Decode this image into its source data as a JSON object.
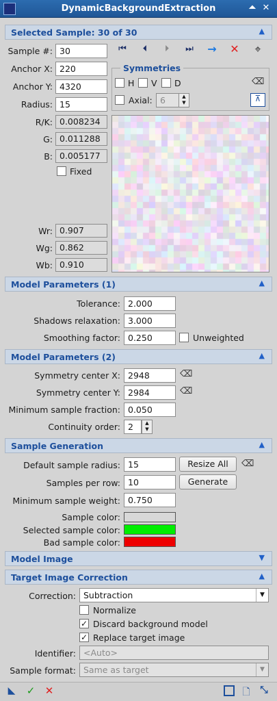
{
  "window": {
    "title": "DynamicBackgroundExtraction"
  },
  "sections": {
    "selected_sample": "Selected Sample: 30 of 30",
    "model_params_1": "Model Parameters (1)",
    "model_params_2": "Model Parameters (2)",
    "sample_generation": "Sample Generation",
    "model_image": "Model Image",
    "target_correction": "Target Image Correction"
  },
  "sample": {
    "sample_num_label": "Sample #:",
    "sample_num": "30",
    "anchor_x_label": "Anchor X:",
    "anchor_x": "220",
    "anchor_y_label": "Anchor Y:",
    "anchor_y": "4320",
    "radius_label": "Radius:",
    "radius": "15",
    "rk_label": "R/K:",
    "rk": "0.008234",
    "g_label": "G:",
    "g": "0.011288",
    "b_label": "B:",
    "b": "0.005177",
    "fixed_label": "Fixed",
    "wr_label": "Wr:",
    "wr": "0.907",
    "wg_label": "Wg:",
    "wg": "0.862",
    "wb_label": "Wb:",
    "wb": "0.910"
  },
  "symmetries": {
    "title": "Symmetries",
    "h": "H",
    "v": "V",
    "d": "D",
    "axial_label": "Axial:",
    "axial": "6"
  },
  "model1": {
    "tolerance_label": "Tolerance:",
    "tolerance": "2.000",
    "shadows_label": "Shadows relaxation:",
    "shadows": "3.000",
    "smoothing_label": "Smoothing factor:",
    "smoothing": "0.250",
    "unweighted_label": "Unweighted"
  },
  "model2": {
    "sym_x_label": "Symmetry center X:",
    "sym_x": "2948",
    "sym_y_label": "Symmetry center Y:",
    "sym_y": "2984",
    "min_frac_label": "Minimum sample fraction:",
    "min_frac": "0.050",
    "continuity_label": "Continuity order:",
    "continuity": "2"
  },
  "generation": {
    "radius_label": "Default sample radius:",
    "radius": "15",
    "resize_all": "Resize All",
    "per_row_label": "Samples per row:",
    "per_row": "10",
    "generate": "Generate",
    "min_weight_label": "Minimum sample weight:",
    "min_weight": "0.750",
    "sample_color_label": "Sample color:",
    "selected_color_label": "Selected sample color:",
    "bad_color_label": "Bad sample color:"
  },
  "colors": {
    "sample": "#d8d8d8",
    "selected": "#00ee00",
    "bad": "#ee0000",
    "accent": "#1d4f9c"
  },
  "correction": {
    "correction_label": "Correction:",
    "correction": "Subtraction",
    "normalize_label": "Normalize",
    "discard_label": "Discard background model",
    "replace_label": "Replace target image",
    "identifier_label": "Identifier:",
    "identifier_placeholder": "<Auto>",
    "format_label": "Sample format:",
    "format": "Same as target"
  }
}
